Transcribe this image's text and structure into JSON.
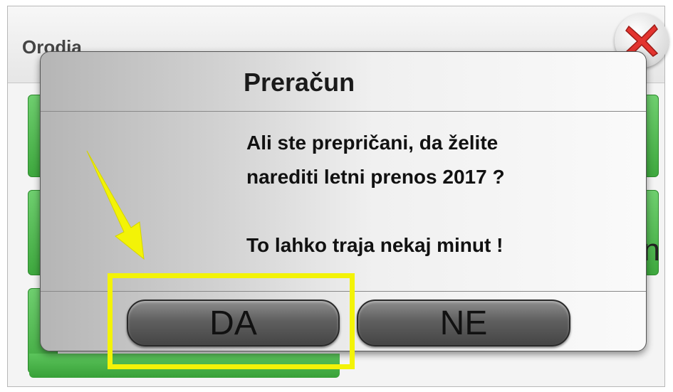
{
  "background_window": {
    "title": "Orodja",
    "right_letter": "n"
  },
  "dialog": {
    "title": "Preračun",
    "message_lines": [
      "Ali ste prepričani, da želite",
      "narediti letni prenos 2017 ?",
      "",
      "To lahko traja nekaj minut !"
    ],
    "buttons": {
      "yes": "DA",
      "no": "NE"
    }
  },
  "colors": {
    "highlight": "#f3f307",
    "close_x": "#e3342f",
    "green": "#4cb84c"
  },
  "icons": {
    "close": "close-x-icon",
    "annotation_arrow": "arrow-icon"
  }
}
